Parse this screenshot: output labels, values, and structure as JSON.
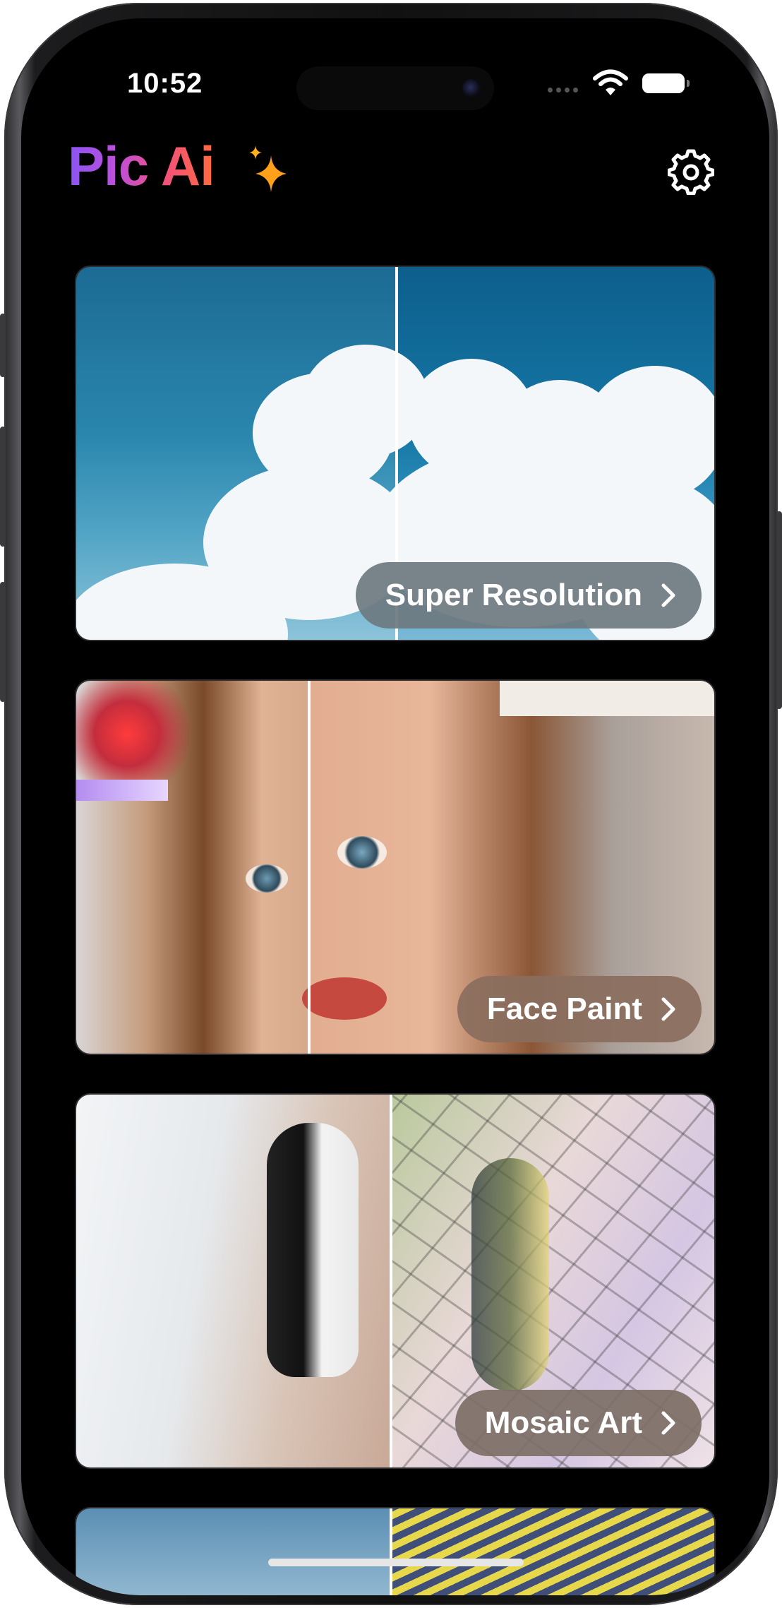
{
  "status_bar": {
    "time": "10:52"
  },
  "header": {
    "title": "Pic Ai"
  },
  "cards": [
    {
      "label": "Super Resolution"
    },
    {
      "label": "Face Paint"
    },
    {
      "label": "Mosaic Art"
    }
  ],
  "colors": {
    "title_gradient": [
      "#8a54f5",
      "#f1507c",
      "#ff6a3d"
    ],
    "sparkle": "#ff9f1a",
    "background": "#000000",
    "pill_super_resolution": "#6f7a80",
    "pill_face_paint": "#8a6e5e",
    "pill_mosaic_art": "#7d6f66"
  },
  "icons": {
    "settings": "gear-icon",
    "sparkle": "sparkle-icon",
    "card_arrow": "chevron-right-icon"
  }
}
